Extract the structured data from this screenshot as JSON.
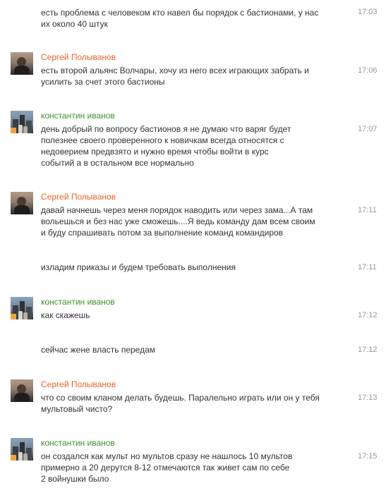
{
  "messages": [
    {
      "id": 1,
      "author": "",
      "time": "17:03",
      "lines": [
        "есть проблема с человеком кто навел бы порядок с бастионами, у нас",
        "их около 40 штук"
      ]
    },
    {
      "id": 2,
      "author": "Сергей Полыванов",
      "author_color": "#e8642a",
      "avatar_icon": "user-avatar-sunset",
      "time": "17:06",
      "lines": [
        "есть второй альянс Волчары, хочу из него всех играющих забрать и",
        "усилить за счет этого бастионы"
      ]
    },
    {
      "id": 3,
      "author": "константин иванов",
      "author_color": "#3f8f2f",
      "avatar_icon": "user-avatar-city",
      "time": "17:07",
      "lines": [
        "день добрый  по  вопросу  бастионов  я  не  думаю  что  варяг  будет",
        " полезнее  своего  проверенного  к  новичкам  всегда  относятся  с",
        " недоверием  предвзято  и  нужно  время  чтобы  войти  в  курс",
        " событий а  в  остальном  все  нормально"
      ]
    },
    {
      "id": 4,
      "author": "Сергей Полыванов",
      "author_color": "#e8642a",
      "avatar_icon": "user-avatar-sunset",
      "time": "17:11",
      "lines": [
        "давай начнешь через меня порядок наводить или через зама...А там",
        "вольешься и без нас уже сможешь....Я ведь команду дам всем своим",
        "и буду спрашивать потом за выполнение команд командиров"
      ]
    },
    {
      "id": 5,
      "author": "",
      "time": "17:11",
      "lines": [
        "изладим приказы и будем требовать выполнения"
      ]
    },
    {
      "id": 6,
      "author": "константин иванов",
      "author_color": "#3f8f2f",
      "avatar_icon": "user-avatar-city",
      "time": "17:12",
      "lines": [
        "как  скажешь"
      ]
    },
    {
      "id": 7,
      "author": "",
      "time": "17:12",
      "lines": [
        "сейчас  жене  власть  передам"
      ]
    },
    {
      "id": 8,
      "author": "Сергей Полыванов",
      "author_color": "#e8642a",
      "avatar_icon": "user-avatar-sunset",
      "time": "17:13",
      "lines": [
        "что со своим кланом делать будешь. Паралельно играть или он у тебя",
        "мультовый чисто?"
      ]
    },
    {
      "id": 9,
      "author": "константин иванов",
      "author_color": "#3f8f2f",
      "avatar_icon": "user-avatar-city",
      "time": "17:15",
      "lines": [
        "он  создался  как  мульт  но  мультов  сразу  не  нашлось  10  мультов",
        " примерно  а   20  дерутся  8-12  отмечаются так  живет  сам  по  себе",
        " 2  войнушки  было"
      ]
    }
  ]
}
